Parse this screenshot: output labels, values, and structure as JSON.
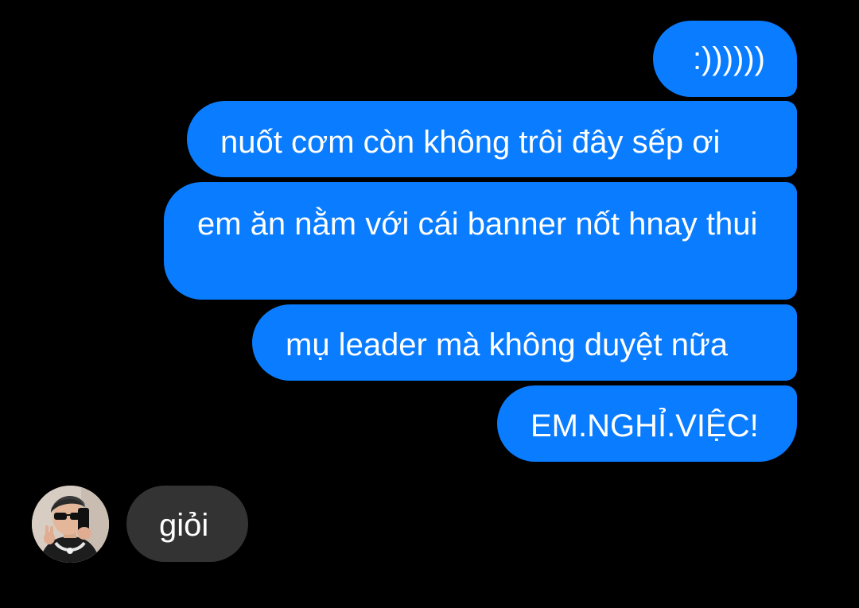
{
  "conversation": {
    "sent_messages": [
      ":))))))",
      "nuốt cơm còn không trôi đây sếp ơi",
      "em ăn nằm với cái banner nốt hnay thui",
      "mụ leader mà không duyệt nữa",
      "EM.NGHỈ.VIỆC!"
    ],
    "received_messages": [
      "giỏi"
    ],
    "avatar_icon": "user-avatar-photo"
  },
  "colors": {
    "background": "#000000",
    "sent_bubble": "#0a7cff",
    "received_bubble": "#333333",
    "text": "#ffffff"
  }
}
